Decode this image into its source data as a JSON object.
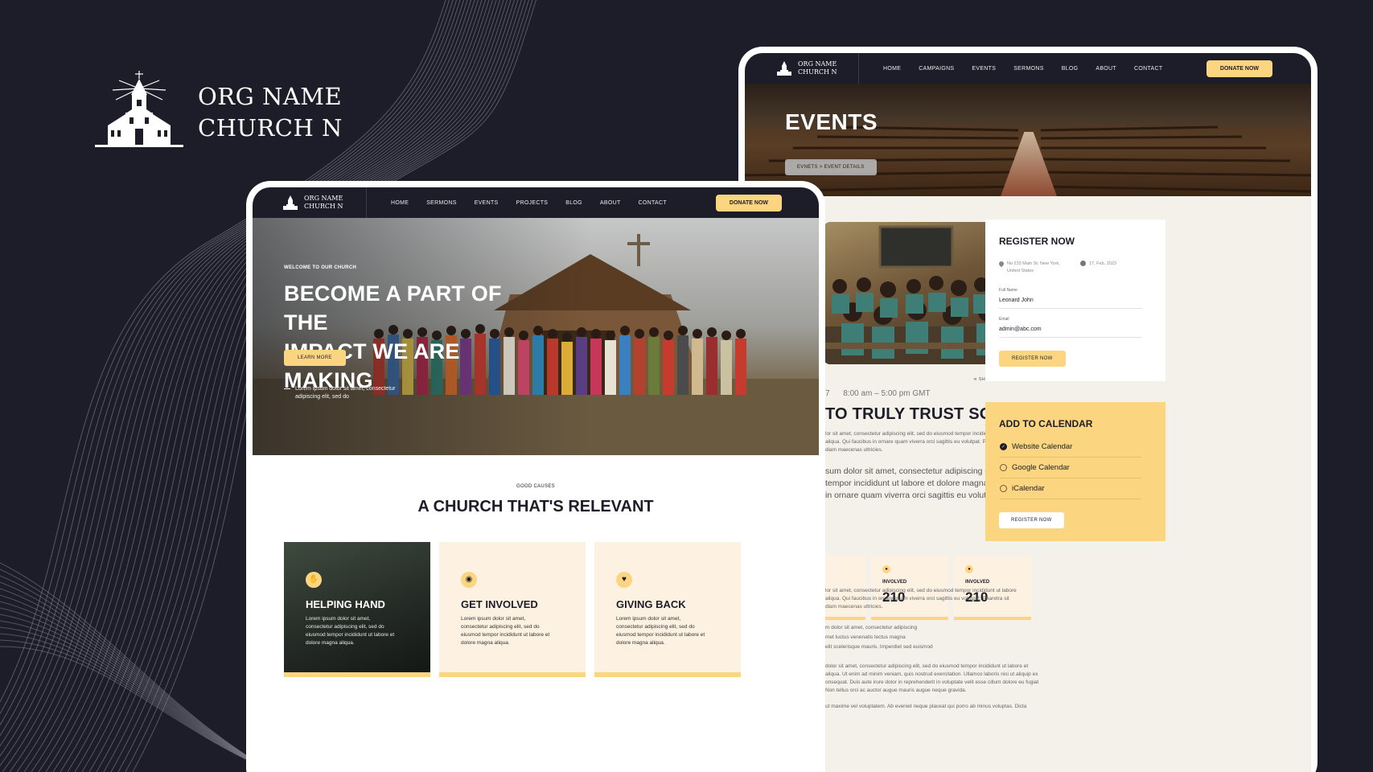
{
  "brand": {
    "line1": "ORG NAME",
    "line2": "CHURCH N"
  },
  "colors": {
    "background": "#1c1d28",
    "accent": "#fcd581",
    "cream": "#fdf1e1",
    "page": "#f4f0ea"
  },
  "events_page": {
    "nav": {
      "logo_line1": "ORG NAME",
      "logo_line2": "CHURCH N",
      "links": [
        "HOME",
        "CAMPAIGNS",
        "EVENTS",
        "SERMONS",
        "BLOG",
        "ABOUT",
        "CONTACT"
      ],
      "donate": "DONATE NOW"
    },
    "hero": {
      "title": "EVENTS",
      "crumb_1": "EVNETS",
      "crumb_sep": ">",
      "crumb_2": "EVENT DETAILS"
    },
    "share": "SHARE EVENT",
    "date_fragment": "7",
    "time": "8:00 am – 5:00 pm GMT",
    "title": "TO TRULY TRUST SOMEONE",
    "p1": [
      "lor sit amet, consectetur adipiscing elit, sed do eiusmod tempor incididunt ut labore",
      "aliqua. Qui faucibus in ornare quam viverra orci sagittis eu volutpat. Pharetra sit",
      "diam maecenas ultricies."
    ],
    "p2": [
      "sum dolor sit amet, consectetur adipiscing elit, sed do",
      "tempor incididunt ut labore et dolore magna aliqua. Dui",
      "in ornare quam viverra orci sagittis eu volutpat."
    ],
    "stats": [
      {
        "label": "INVOLVED",
        "value": "210"
      },
      {
        "label": "INVOLVED",
        "value": "210"
      }
    ],
    "p3": [
      "lor sit amet, consectetur adipiscing elit, sed do eiusmod tempor incididunt ut labore",
      "aliqua. Qui faucibus in ornare quam viverra orci sagittis eu volutpat. Pharetra sit",
      "diam maecenas ultricies."
    ],
    "list": [
      "m dolor sit amet, consectetur adipiscing",
      "met luctus venenatis lectus magna",
      "elit scelerisque mauris. Imperdiet sed euismod"
    ],
    "p4": [
      "dolor sit amet, consectetur adipiscing elit, sed do eiusmod tempor incididunt ut labore et",
      "aliqua. Ut enim ad minim veniam, quis nostrud exercitation. Ullamco laboris nisi ut aliquip ex",
      "onsequat. Duis aute irure dolor in reprehenderit in voluptate velit esse cillum dolore eu fugiat",
      "Non tellus orci ac auctor augue mauris augue neque gravida."
    ],
    "p5": "ut maxime vel voluptatem. Ab eveniet neque placeat qui porro ab minus voluptas. Dicta",
    "register": {
      "title": "REGISTER NOW",
      "address_1": "No 233 Main St. New York,",
      "address_2": "United States",
      "date": "17, Feb, 2023",
      "name_label": "Full Name",
      "name_value": "Leonard John",
      "email_label": "Email",
      "email_value": "admin@abc.com",
      "button": "REGISTER NOW"
    },
    "calendar": {
      "title": "ADD TO CALENDAR",
      "options": [
        "Website Calendar",
        "Google Calendar",
        "iCalendar"
      ],
      "selected": "Website Calendar",
      "button": "REGISTER NOW"
    }
  },
  "home_page": {
    "nav": {
      "logo_line1": "ORG NAME",
      "logo_line2": "CHURCH N",
      "links": [
        "HOME",
        "SERMONS",
        "EVENTS",
        "PROJECTS",
        "BLOG",
        "ABOUT",
        "CONTACT"
      ],
      "donate": "DONATE NOW"
    },
    "hero": {
      "welcome": "WELCOME TO OUR CHURCH",
      "title_1": "BECOME A PART OF THE",
      "title_2": "IMPACT WE ARE MAKING",
      "button": "LEARN MORE",
      "caption_1": "Lorem ipsum dolor sit amet, consectetur",
      "caption_2": "adipiscing elit, sed do"
    },
    "section": {
      "eyebrow": "GOOD CAUSES",
      "title": "A CHURCH THAT'S RELEVANT"
    },
    "causes": [
      {
        "title": "HELPING HAND",
        "icon": "hands-icon",
        "text_1": "Lorem ipsum dolor sit amet,",
        "text_2": "consectetur adipiscing elit, sed do",
        "text_3": "eiusmod tempor incididunt ut labore et",
        "text_4": "dolore magna aliqua."
      },
      {
        "title": "GET INVOLVED",
        "icon": "signal-icon",
        "text_1": "Lorem ipsum dolor sit amet,",
        "text_2": "consectetur adipiscing elit, sed do",
        "text_3": "eiusmod tempor incididunt ut labore et",
        "text_4": "dolore magna aliqua."
      },
      {
        "title": "GIVING BACK",
        "icon": "giving-hand-icon",
        "text_1": "Lorem ipsum dolor sit amet,",
        "text_2": "consectetur adipiscing elit, sed do",
        "text_3": "eiusmod tempor incididunt ut labore et",
        "text_4": "dolore magna aliqua."
      }
    ]
  }
}
